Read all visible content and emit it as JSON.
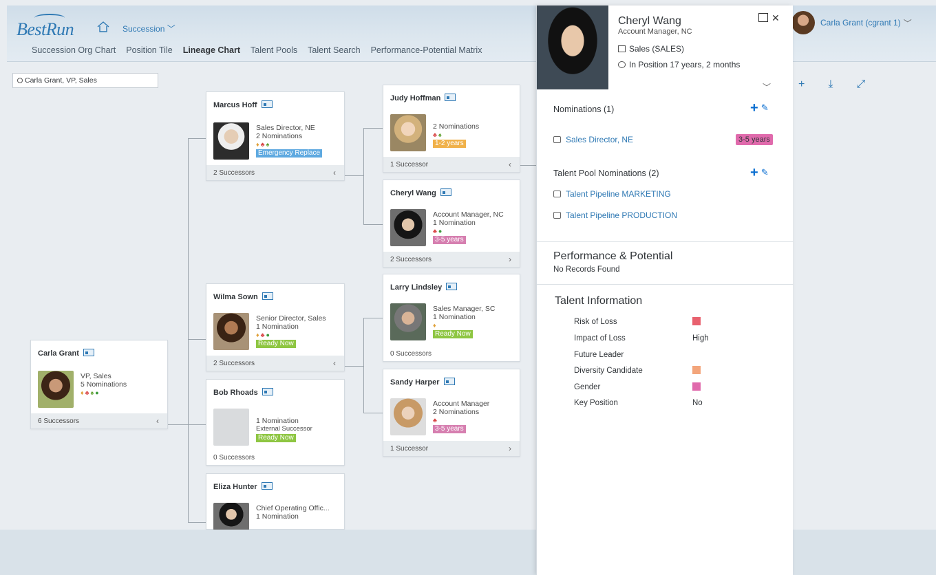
{
  "shell": {
    "logo": "BestRun",
    "app_menu": "Succession",
    "tabs": [
      "Succession Org Chart",
      "Position Tile",
      "Lineage Chart",
      "Talent Pools",
      "Talent Search",
      "Performance-Potential Matrix"
    ],
    "active_tab": "Lineage Chart",
    "user": "Carla Grant (cgrant 1)"
  },
  "search": {
    "value": "Carla Grant, VP, Sales"
  },
  "cards": {
    "carla": {
      "name": "Carla Grant",
      "title": "VP, Sales",
      "nominations": "5 Nominations",
      "successors": "6 Successors"
    },
    "marcus": {
      "name": "Marcus Hoff",
      "title": "Sales Director, NE",
      "nominations": "2 Nominations",
      "tag": "Emergency Replace",
      "successors": "2 Successors"
    },
    "wilma": {
      "name": "Wilma Sown",
      "title": "Senior Director, Sales",
      "nominations": "1 Nomination",
      "tag": "Ready Now",
      "successors": "2 Successors"
    },
    "bob": {
      "name": "Bob Rhoads",
      "nominations": "1 Nomination",
      "note": "External Successor",
      "tag": "Ready Now",
      "successors": "0 Successors"
    },
    "eliza": {
      "name": "Eliza Hunter",
      "title": "Chief Operating Offic...",
      "nominations": "1 Nomination"
    },
    "judy": {
      "name": "Judy Hoffman",
      "nominations": "2 Nominations",
      "tag": "1-2 years",
      "successors": "1 Successor"
    },
    "cheryl": {
      "name": "Cheryl Wang",
      "title": "Account Manager, NC",
      "nominations": "1 Nomination",
      "tag": "3-5 years",
      "successors": "2 Successors"
    },
    "larry": {
      "name": "Larry Lindsley",
      "title": "Sales Manager, SC",
      "nominations": "1 Nomination",
      "tag": "Ready Now",
      "successors": "0 Successors"
    },
    "sandy": {
      "name": "Sandy Harper",
      "title": "Account Manager",
      "nominations": "2 Nominations",
      "tag": "3-5 years",
      "successors": "1 Successor"
    }
  },
  "panel": {
    "name": "Cheryl Wang",
    "title": "Account Manager, NC",
    "department": "Sales (SALES)",
    "tenure": "In Position 17 years, 2 months",
    "nominations_header": "Nominations (1)",
    "nomination_link": "Sales Director, NE",
    "nomination_readiness": "3-5 years",
    "pool_header": "Talent Pool Nominations (2)",
    "pools": [
      "Talent Pipeline MARKETING",
      "Talent Pipeline PRODUCTION"
    ],
    "perf_header": "Performance & Potential",
    "perf_value": "No Records Found",
    "talent_header": "Talent Information",
    "talent_rows": [
      {
        "label": "Risk of Loss",
        "value": ""
      },
      {
        "label": "Impact of Loss",
        "value": "High"
      },
      {
        "label": "Future Leader",
        "value": ""
      },
      {
        "label": "Diversity Candidate",
        "value": ""
      },
      {
        "label": "Gender",
        "value": ""
      },
      {
        "label": "Key Position",
        "value": "No"
      }
    ]
  },
  "colors": {
    "accent": "#2f79b4",
    "ready_now": "#8ec642",
    "years_1_2": "#f0b14a",
    "years_3_5": "#d67fb0",
    "emergency": "#5ea9e0"
  }
}
